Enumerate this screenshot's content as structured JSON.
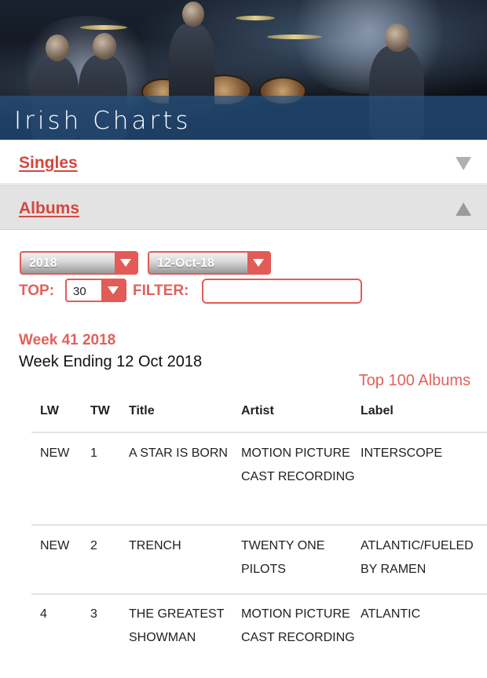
{
  "header": {
    "title": "Irish Charts"
  },
  "accordion": {
    "singles_label": "Singles",
    "albums_label": "Albums"
  },
  "controls": {
    "year": "2018",
    "date": "12-Oct-18",
    "top_label": "TOP:",
    "top_value": "30",
    "filter_label": "FILTER:",
    "filter_value": ""
  },
  "week": {
    "title": "Week 41 2018",
    "ending": "Week Ending 12 Oct 2018",
    "top100_link": "Top 100 Albums"
  },
  "table": {
    "headers": [
      "LW",
      "TW",
      "Title",
      "Artist",
      "Label"
    ],
    "rows": [
      {
        "lw": "NEW",
        "tw": "1",
        "title": "A STAR IS BORN",
        "artist": "MOTION PICTURE CAST RECORDING",
        "label": "INTERSCOPE"
      },
      {
        "lw": "NEW",
        "tw": "2",
        "title": "TRENCH",
        "artist": "TWENTY ONE PILOTS",
        "label": "ATLANTIC/FUELED BY RAMEN"
      },
      {
        "lw": "4",
        "tw": "3",
        "title": "THE GREATEST SHOWMAN",
        "artist": "MOTION PICTURE CAST RECORDING",
        "label": "ATLANTIC"
      }
    ]
  }
}
